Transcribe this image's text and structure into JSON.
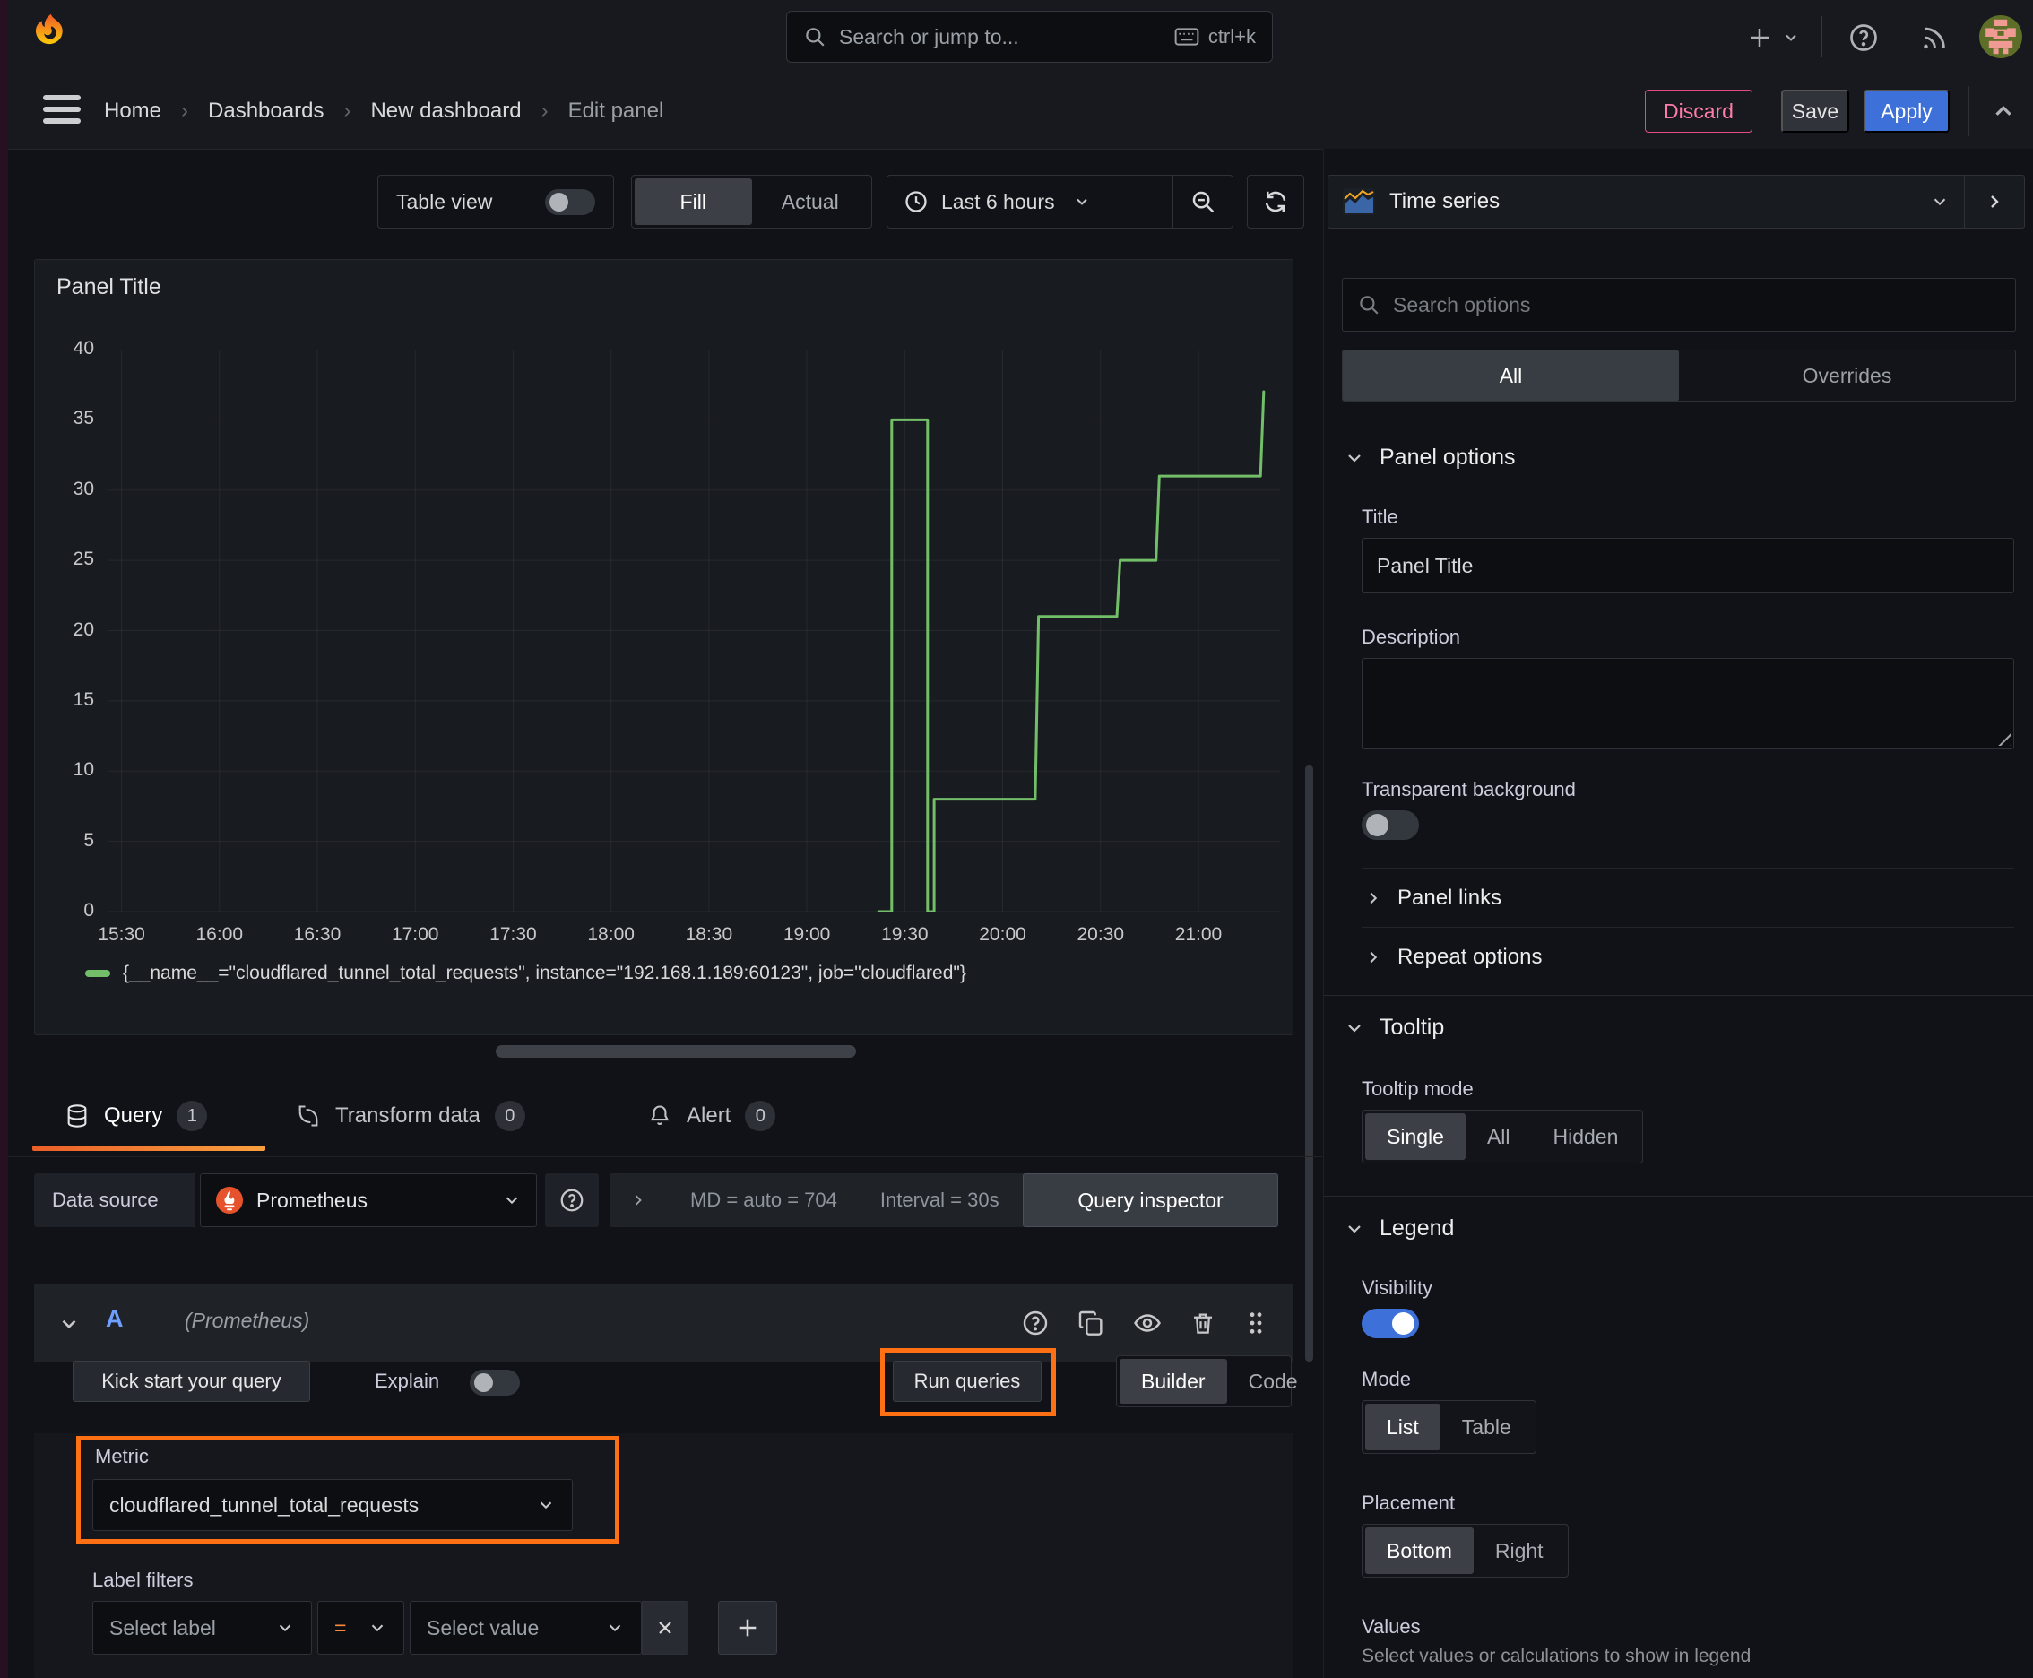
{
  "topbar": {
    "search_placeholder": "Search or jump to...",
    "search_shortcut": "ctrl+k"
  },
  "breadcrumb": {
    "items": [
      "Home",
      "Dashboards",
      "New dashboard",
      "Edit panel"
    ],
    "separator": "›"
  },
  "actions": {
    "discard": "Discard",
    "save": "Save",
    "apply": "Apply"
  },
  "view_toolbar": {
    "table_view": "Table view",
    "fill": "Fill",
    "actual": "Actual",
    "time_range": "Last 6 hours"
  },
  "panel": {
    "title": "Panel Title"
  },
  "chart_data": {
    "type": "line",
    "mode": "stepped",
    "title": "Panel Title",
    "x_start": "15:26",
    "x_end": "21:25",
    "x_ticks": [
      "15:30",
      "16:00",
      "16:30",
      "17:00",
      "17:30",
      "18:00",
      "18:30",
      "19:00",
      "19:30",
      "20:00",
      "20:30",
      "21:00"
    ],
    "y_ticks": [
      0,
      5,
      10,
      15,
      20,
      25,
      30,
      35,
      40
    ],
    "ylim": [
      0,
      40
    ],
    "grid": true,
    "legend_position": "bottom",
    "series": [
      {
        "name": "{__name__=\"cloudflared_tunnel_total_requests\", instance=\"192.168.1.189:60123\", job=\"cloudflared\"}",
        "color": "#73bf69",
        "points": [
          [
            "19:22",
            0
          ],
          [
            "19:26",
            0
          ],
          [
            "19:26",
            35
          ],
          [
            "19:37",
            35
          ],
          [
            "19:37",
            0
          ],
          [
            "19:39",
            0
          ],
          [
            "19:39",
            8
          ],
          [
            "20:10",
            8
          ],
          [
            "20:11",
            21
          ],
          [
            "20:35",
            21
          ],
          [
            "20:36",
            25
          ],
          [
            "20:47",
            25
          ],
          [
            "20:48",
            31
          ],
          [
            "21:19",
            31
          ],
          [
            "21:20",
            37
          ]
        ]
      }
    ]
  },
  "editor_tabs": {
    "query": {
      "label": "Query",
      "count": "1"
    },
    "transform": {
      "label": "Transform data",
      "count": "0"
    },
    "alert": {
      "label": "Alert",
      "count": "0"
    }
  },
  "datasource_bar": {
    "label": "Data source",
    "value": "Prometheus",
    "max_data_points": "MD = auto = 704",
    "interval": "Interval = 30s",
    "query_inspector": "Query inspector"
  },
  "query_row": {
    "ref_id": "A",
    "datasource_note": "(Prometheus)"
  },
  "query_toolbar": {
    "kick_start": "Kick start your query",
    "explain": "Explain",
    "run_queries": "Run queries",
    "builder": "Builder",
    "code": "Code"
  },
  "query_builder": {
    "metric_label": "Metric",
    "metric_value": "cloudflared_tunnel_total_requests",
    "label_filters": "Label filters",
    "select_label": "Select label",
    "operator": "=",
    "select_value": "Select value"
  },
  "sidebar": {
    "visualization": "Time series",
    "search_placeholder": "Search options",
    "tabs": {
      "all": "All",
      "overrides": "Overrides"
    },
    "panel_options": {
      "heading": "Panel options",
      "title_label": "Title",
      "title_value": "Panel Title",
      "description_label": "Description",
      "transparent_label": "Transparent background"
    },
    "panel_links": {
      "heading": "Panel links"
    },
    "repeat_options": {
      "heading": "Repeat options"
    },
    "tooltip": {
      "heading": "Tooltip",
      "mode_label": "Tooltip mode",
      "options": [
        "Single",
        "All",
        "Hidden"
      ],
      "selected": "Single"
    },
    "legend": {
      "heading": "Legend",
      "visibility_label": "Visibility",
      "mode_label": "Mode",
      "mode_options": [
        "List",
        "Table"
      ],
      "mode_selected": "List",
      "placement_label": "Placement",
      "placement_options": [
        "Bottom",
        "Right"
      ],
      "placement_selected": "Bottom",
      "values_label": "Values",
      "values_help": "Select values or calculations to show in legend"
    }
  }
}
